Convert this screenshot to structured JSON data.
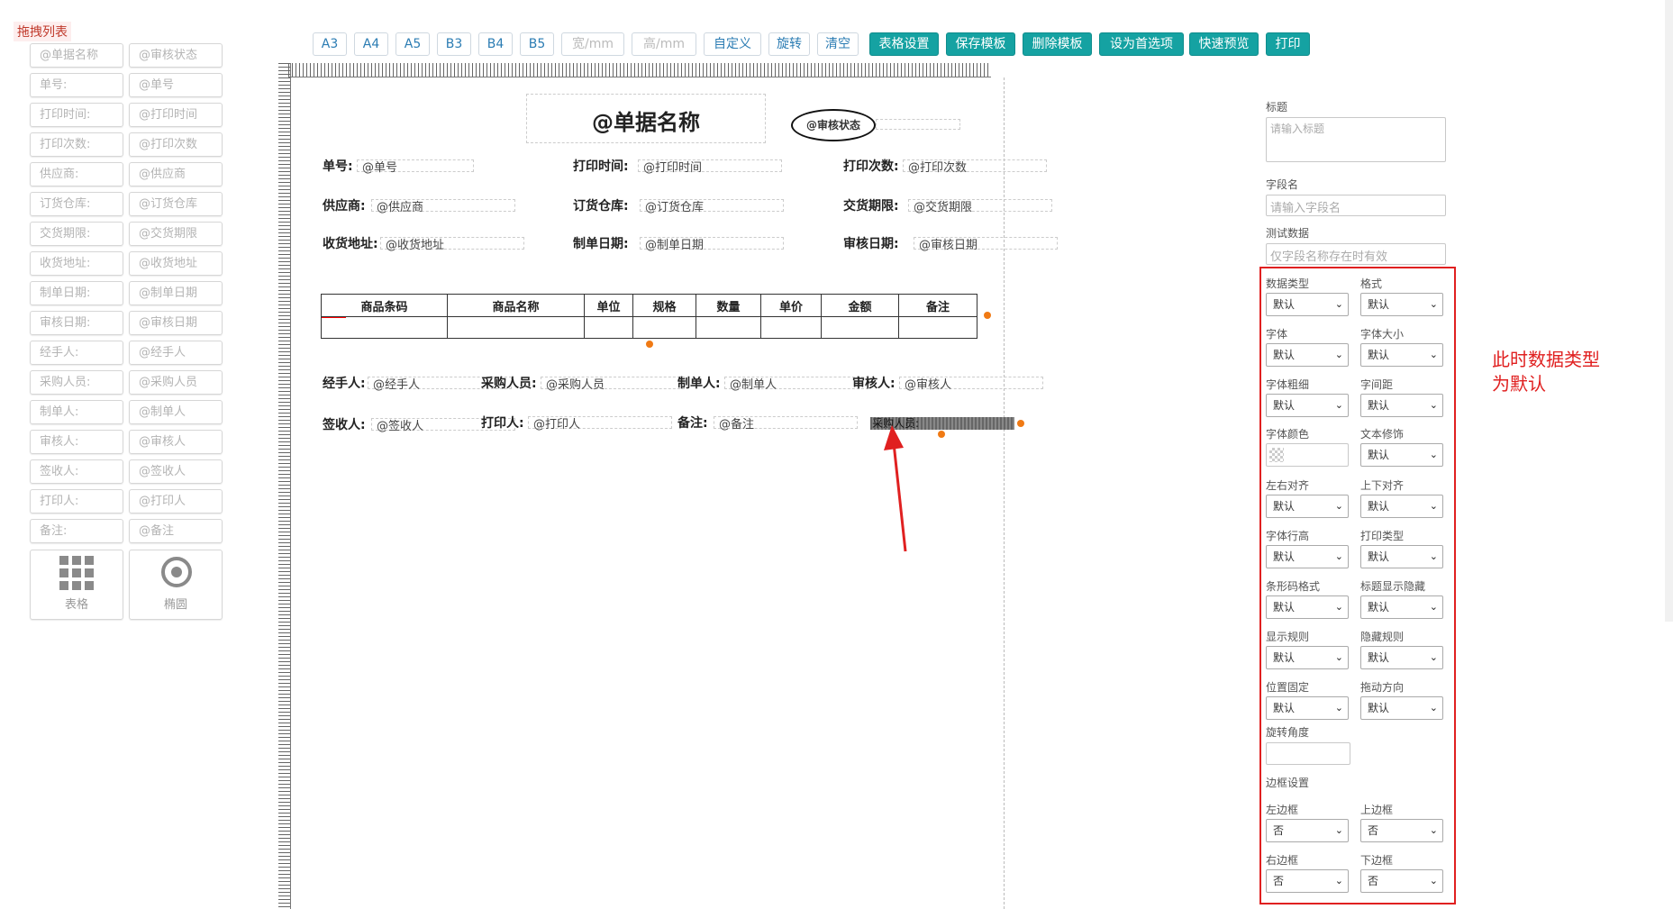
{
  "drag_panel": {
    "title": "拖拽列表",
    "items": [
      {
        "label": "@单据名称",
        "value": "@审核状态"
      },
      {
        "label": "单号:",
        "value": "@单号"
      },
      {
        "label": "打印时间:",
        "value": "@打印时间"
      },
      {
        "label": "打印次数:",
        "value": "@打印次数"
      },
      {
        "label": "供应商:",
        "value": "@供应商"
      },
      {
        "label": "订货仓库:",
        "value": "@订货仓库"
      },
      {
        "label": "交货期限:",
        "value": "@交货期限"
      },
      {
        "label": "收货地址:",
        "value": "@收货地址"
      },
      {
        "label": "制单日期:",
        "value": "@制单日期"
      },
      {
        "label": "审核日期:",
        "value": "@审核日期"
      },
      {
        "label": "经手人:",
        "value": "@经手人"
      },
      {
        "label": "采购人员:",
        "value": "@采购人员"
      },
      {
        "label": "制单人:",
        "value": "@制单人"
      },
      {
        "label": "审核人:",
        "value": "@审核人"
      },
      {
        "label": "签收人:",
        "value": "@签收人"
      },
      {
        "label": "打印人:",
        "value": "@打印人"
      },
      {
        "label": "备注:",
        "value": "@备注"
      }
    ],
    "table_tile": "表格",
    "ellipse_tile": "椭圆"
  },
  "toolbar": {
    "a3": "A3",
    "a4": "A4",
    "a5": "A5",
    "b3": "B3",
    "b4": "B4",
    "b5": "B5",
    "width": "宽/mm",
    "height": "高/mm",
    "custom": "自定义",
    "rotate": "旋转",
    "clear": "清空",
    "table_settings": "表格设置",
    "save_template": "保存模板",
    "delete_template": "删除模板",
    "set_preferred": "设为首选项",
    "quick_preview": "快速预览",
    "print": "打印"
  },
  "canvas": {
    "doc_title": "@单据名称",
    "status": "@审核状态",
    "fields": {
      "order_no": {
        "label": "单号:",
        "value": "@单号"
      },
      "print_time": {
        "label": "打印时间:",
        "value": "@打印时间"
      },
      "print_count": {
        "label": "打印次数:",
        "value": "@打印次数"
      },
      "supplier": {
        "label": "供应商:",
        "value": "@供应商"
      },
      "warehouse": {
        "label": "订货仓库:",
        "value": "@订货仓库"
      },
      "deadline": {
        "label": "交货期限:",
        "value": "@交货期限"
      },
      "address": {
        "label": "收货地址:",
        "value": "@收货地址"
      },
      "made_date": {
        "label": "制单日期:",
        "value": "@制单日期"
      },
      "audit_date": {
        "label": "审核日期:",
        "value": "@审核日期"
      },
      "handler": {
        "label": "经手人:",
        "value": "@经手人"
      },
      "buyer": {
        "label": "采购人员:",
        "value": "@采购人员"
      },
      "maker": {
        "label": "制单人:",
        "value": "@制单人"
      },
      "auditor": {
        "label": "审核人:",
        "value": "@审核人"
      },
      "receiver": {
        "label": "签收人:",
        "value": "@签收人"
      },
      "printer": {
        "label": "打印人:",
        "value": "@打印人"
      },
      "remark": {
        "label": "备注:",
        "value": "@备注"
      }
    },
    "selected_field": "采购人员:",
    "table_headers": [
      "商品条码",
      "商品名称",
      "单位",
      "规格",
      "数量",
      "单价",
      "金额",
      "备注"
    ]
  },
  "props": {
    "title_label": "标题",
    "title_placeholder": "请输入标题",
    "field_label": "字段名",
    "field_placeholder": "请输入字段名",
    "test_label": "测试数据",
    "test_placeholder": "仅字段名称存在时有效",
    "selects": [
      {
        "label": "数据类型",
        "value": "默认"
      },
      {
        "label": "格式",
        "value": "默认"
      },
      {
        "label": "字体",
        "value": "默认"
      },
      {
        "label": "字体大小",
        "value": "默认"
      },
      {
        "label": "字体粗细",
        "value": "默认"
      },
      {
        "label": "字间距",
        "value": "默认"
      },
      {
        "label": "左右对齐",
        "value": "默认"
      },
      {
        "label": "上下对齐",
        "value": "默认"
      },
      {
        "label": "字体行高",
        "value": "默认"
      },
      {
        "label": "打印类型",
        "value": "默认"
      },
      {
        "label": "条形码格式",
        "value": "默认"
      },
      {
        "label": "标题显示隐藏",
        "value": "默认"
      },
      {
        "label": "显示规则",
        "value": "默认"
      },
      {
        "label": "隐藏规则",
        "value": "默认"
      },
      {
        "label": "位置固定",
        "value": "默认"
      },
      {
        "label": "拖动方向",
        "value": "默认"
      }
    ],
    "font_color_label": "字体颜色",
    "text_decoration": {
      "label": "文本修饰",
      "value": "默认"
    },
    "rotate_label": "旋转角度",
    "border_section": "边框设置",
    "borders": [
      {
        "label": "左边框",
        "value": "否"
      },
      {
        "label": "上边框",
        "value": "否"
      },
      {
        "label": "右边框",
        "value": "否"
      },
      {
        "label": "下边框",
        "value": "否"
      }
    ]
  },
  "annotation": {
    "line1": "此时数据类型",
    "line2": "为默认",
    "color": "#e02020"
  },
  "colors": {
    "teal": "#15a2a2",
    "orange_handle": "#f07a14",
    "red_marker": "#ff0000"
  }
}
